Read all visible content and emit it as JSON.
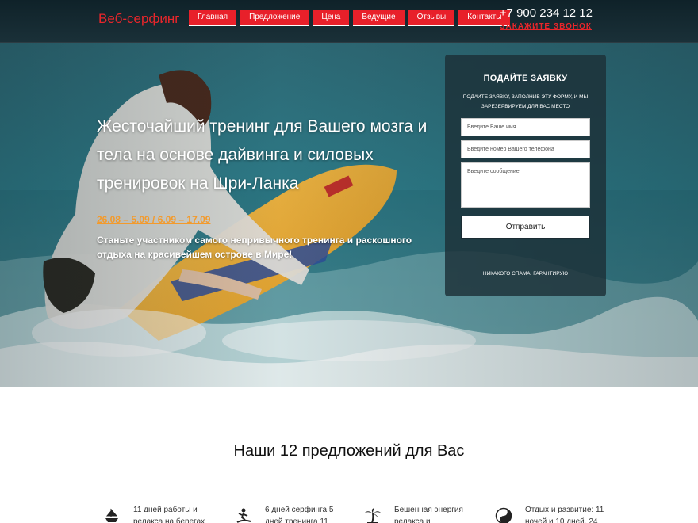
{
  "header": {
    "logo": "Веб-серфинг",
    "nav": [
      "Главная",
      "Предложение",
      "Цена",
      "Ведущие",
      "Отзывы",
      "Контакты"
    ],
    "phone": "+7 900 234 12 12",
    "callback": "ЗАКАЖИТЕ ЗВОНОК"
  },
  "hero": {
    "title": "Жесточайший тренинг для Вашего мозга и тела на основе дайвинга и силовых тренировок на Шри-Ланка",
    "dates": "26.08 – 5.09 / 6.09 – 17.09",
    "subtitle": "Станьте участником самого непривычного тренинга и раскошного отдыха на красивейшем острове в Мире!"
  },
  "form": {
    "title": "ПОДАЙТЕ ЗАЯВКУ",
    "description": "ПОДАЙТЕ ЗАЯВКУ, ЗАПОЛНИВ ЭТУ ФОРМУ, И МЫ ЗАРЕЗЕРВИРУЕМ ДЛЯ ВАС МЕСТО",
    "name_placeholder": "Введите Ваше имя",
    "phone_placeholder": "Введите номер Вашего телефона",
    "message_placeholder": "Введите сообщение",
    "submit": "Отправить",
    "note": "НИКАКОГО СПАМА, ГАРАНТИРУЮ"
  },
  "offers": {
    "title": "Наши 12 предложений для Вас",
    "items": [
      {
        "icon": "ship-icon",
        "text": "11 дней работы и релакса на берегах"
      },
      {
        "icon": "surfer-icon",
        "text": "6 дней серфинга 5 дней тренинга 11"
      },
      {
        "icon": "palm-icon",
        "text": "Бешенная энергия релакса и"
      },
      {
        "icon": "yin-yang-icon",
        "text": "Отдых и развитие: 11 ночей и 10 дней, 24"
      }
    ]
  },
  "colors": {
    "accent": "#e8202a",
    "dates": "#f39a2b",
    "header": "#13272e"
  }
}
